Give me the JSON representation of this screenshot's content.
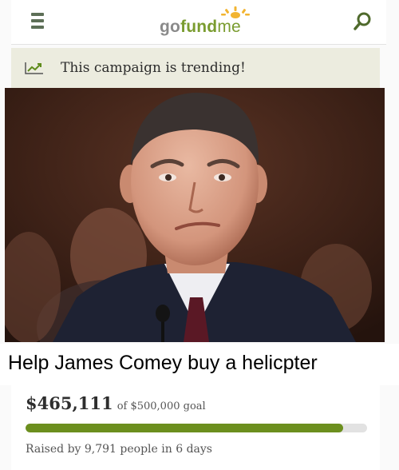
{
  "header": {
    "logo": {
      "part1": "go",
      "part2": "fund",
      "part3": "me"
    },
    "menu_icon": "hamburger-menu-icon",
    "search_icon": "search-icon"
  },
  "trending": {
    "icon": "trending-chart-icon",
    "text": "This campaign is trending!"
  },
  "photo": {
    "subject": "campaign-photo"
  },
  "caption": "Help James Comey buy a helicpter",
  "funding": {
    "amount": "$465,111",
    "goal_text": "of $500,000 goal",
    "progress_fraction": 0.93,
    "raised_text": "Raised by 9,791 people in 6 days"
  },
  "colors": {
    "brand_green": "#7a9c2f",
    "progress_green": "#6c8f1e",
    "trending_bg": "#ececdf"
  }
}
